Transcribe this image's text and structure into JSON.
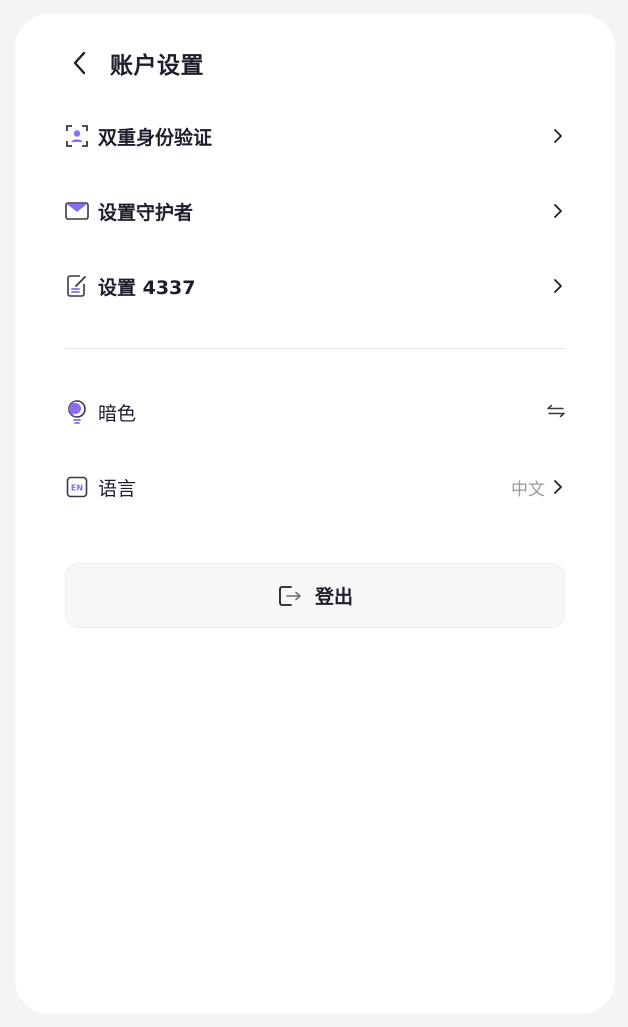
{
  "header": {
    "title": "账户设置"
  },
  "menu": {
    "items": [
      {
        "label": "双重身份验证",
        "icon": "user-scan-icon"
      },
      {
        "label": "设置守护者",
        "icon": "envelope-icon"
      },
      {
        "label": "设置 4337",
        "icon": "document-edit-icon"
      }
    ]
  },
  "preferences": {
    "items": [
      {
        "label": "暗色",
        "icon": "bulb-icon",
        "control": "swap-icon"
      },
      {
        "label": "语言",
        "icon": "en-icon",
        "value": "中文"
      }
    ]
  },
  "logout": {
    "label": "登出",
    "icon": "logout-icon"
  },
  "colors": {
    "accent": "#8b6cf0",
    "text": "#1f1d2b",
    "background": "#f4f4f5"
  }
}
